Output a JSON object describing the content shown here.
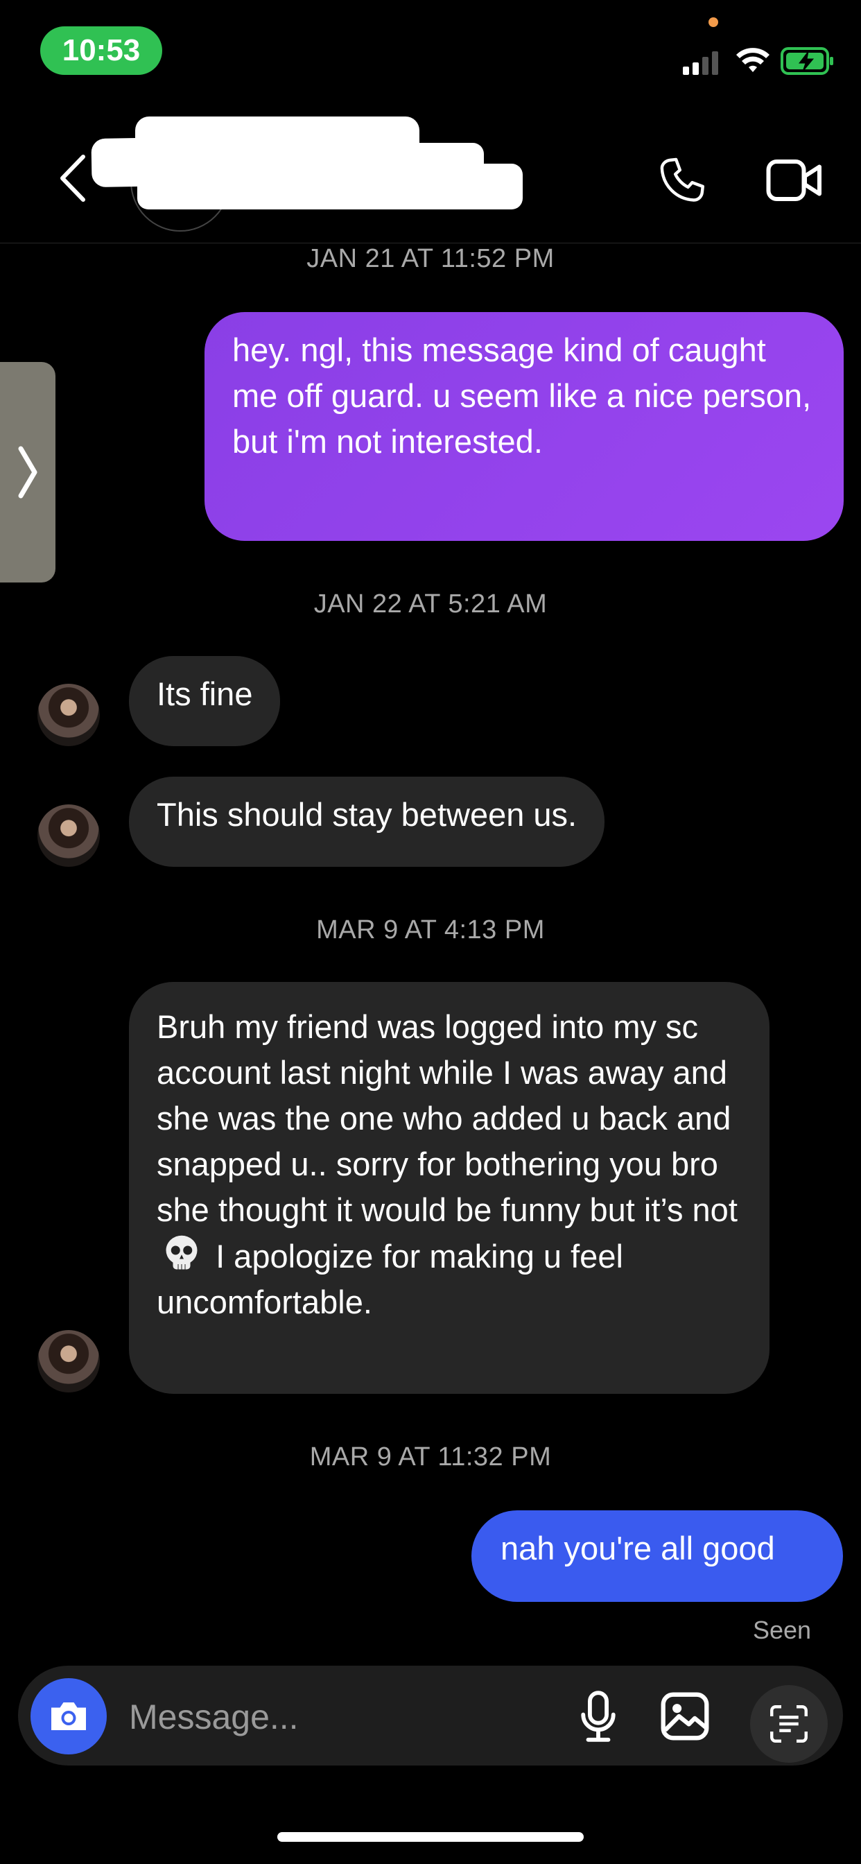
{
  "status_bar": {
    "time": "10:53"
  },
  "header": {
    "contact_name_redacted": ""
  },
  "timestamps": {
    "t1": "JAN 21 AT 11:52 PM",
    "t2": "JAN 22 AT 5:21 AM",
    "t3": "MAR 9 AT 4:13 PM",
    "t4": "MAR 9 AT 11:32 PM"
  },
  "messages": {
    "m1": "hey. ngl, this message kind of caught me off guard. u seem like a nice person, but i'm not interested.",
    "m2": "Its fine",
    "m3": "This should stay between us.",
    "m4_part1": "Bruh my friend was logged into my sc account last night while I was away and she was the one who added u back and snapped u.. sorry for bothering you bro she thought it would be funny but it’s not",
    "m4_part2": "I apologize for making u feel uncomfortable.",
    "m5": "nah you're all good"
  },
  "seen_label": "Seen",
  "composer": {
    "placeholder": "Message..."
  },
  "icons": {
    "back": "chevron-left-icon",
    "call": "phone-icon",
    "video": "video-camera-icon",
    "camera": "camera-icon",
    "mic": "microphone-icon",
    "gallery": "image-icon",
    "scan": "text-scan-icon"
  },
  "colors": {
    "time_pill": "#30c153",
    "sent_purple": "#8a3fe6",
    "sent_blue": "#3a5bef",
    "received": "#262626",
    "camera_button": "#3b61ef"
  }
}
